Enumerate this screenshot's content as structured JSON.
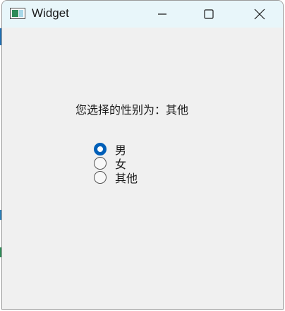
{
  "window": {
    "title": "Widget",
    "icon": "app-window-icon",
    "controls": {
      "minimize_icon": "minimize-icon",
      "maximize_icon": "maximize-icon",
      "close_icon": "close-icon"
    }
  },
  "content": {
    "result_text": "您选择的性别为：其他"
  },
  "gender_options": [
    {
      "label": "男",
      "checked": true
    },
    {
      "label": "女",
      "checked": false
    },
    {
      "label": "其他",
      "checked": false
    }
  ],
  "colors": {
    "titlebar_bg": "#e8f6fa",
    "client_bg": "#f0f0f0",
    "radio_accent": "#005fb8"
  }
}
